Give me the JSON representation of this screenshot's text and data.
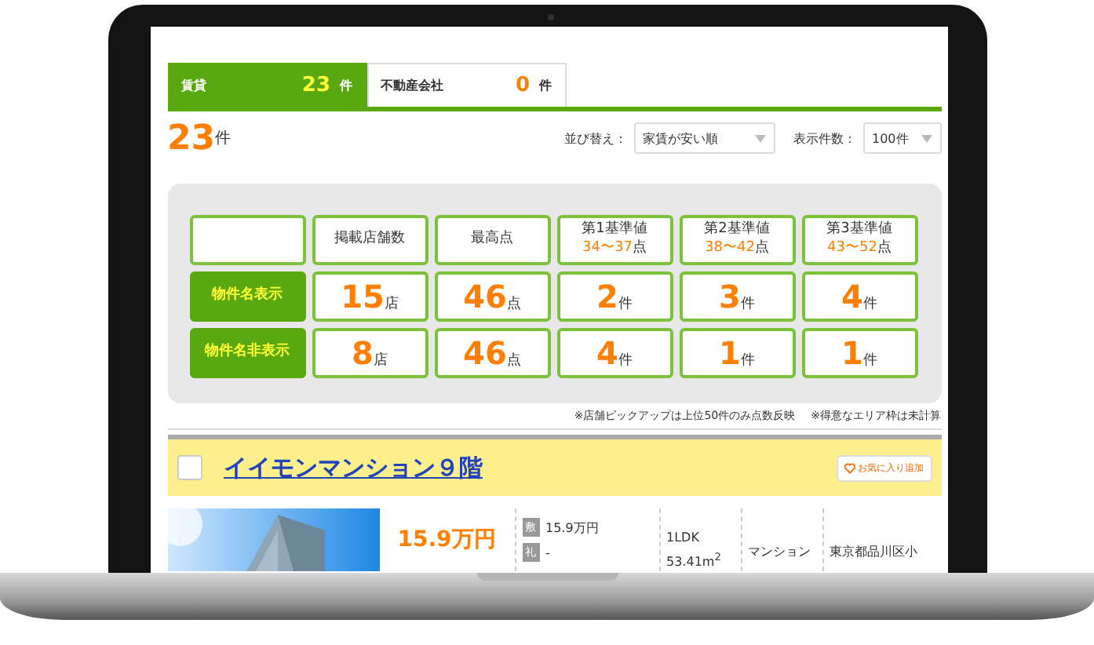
{
  "tabs": [
    {
      "label": "賃貸",
      "count": "23",
      "unit": "件",
      "selected": true
    },
    {
      "label": "不動産会社",
      "count": "0",
      "unit": "件",
      "selected": false
    }
  ],
  "result_count": {
    "value": "23",
    "unit": "件"
  },
  "sort": {
    "label": "並び替え：",
    "value": "家賃が安い順"
  },
  "per_page": {
    "label": "表示件数：",
    "value": "100件"
  },
  "score_table": {
    "columns": [
      {
        "title": "掲載店舗数"
      },
      {
        "title": "最高点"
      },
      {
        "title": "第1基準値",
        "range": "34〜37",
        "unit": "点"
      },
      {
        "title": "第2基準値",
        "range": "38〜42",
        "unit": "点"
      },
      {
        "title": "第3基準値",
        "range": "43〜52",
        "unit": "点"
      }
    ],
    "rows": [
      {
        "label": "物件名表示",
        "cells": [
          {
            "value": "15",
            "unit": "店"
          },
          {
            "value": "46",
            "unit": "点"
          },
          {
            "value": "2",
            "unit": "件"
          },
          {
            "value": "3",
            "unit": "件"
          },
          {
            "value": "4",
            "unit": "件"
          }
        ]
      },
      {
        "label": "物件名非表示",
        "cells": [
          {
            "value": "8",
            "unit": "店"
          },
          {
            "value": "46",
            "unit": "点"
          },
          {
            "value": "4",
            "unit": "件"
          },
          {
            "value": "1",
            "unit": "件"
          },
          {
            "value": "1",
            "unit": "件"
          }
        ]
      }
    ]
  },
  "notes": [
    "※店舗ピックアップは上位50件のみ点数反映",
    "※得意なエリア枠は未計算"
  ],
  "listing": {
    "checked": false,
    "title": "イイモンマンション９階",
    "favorite_button": "お気に入り追加",
    "price": "15.9万円",
    "deposit": {
      "badge": "敷",
      "value": "15.9万円"
    },
    "key_money": {
      "badge": "礼",
      "value": "-"
    },
    "layout": "1LDK",
    "area": "53.41m$^{2}$",
    "type": "マンション",
    "address": "東京都品川区小"
  }
}
